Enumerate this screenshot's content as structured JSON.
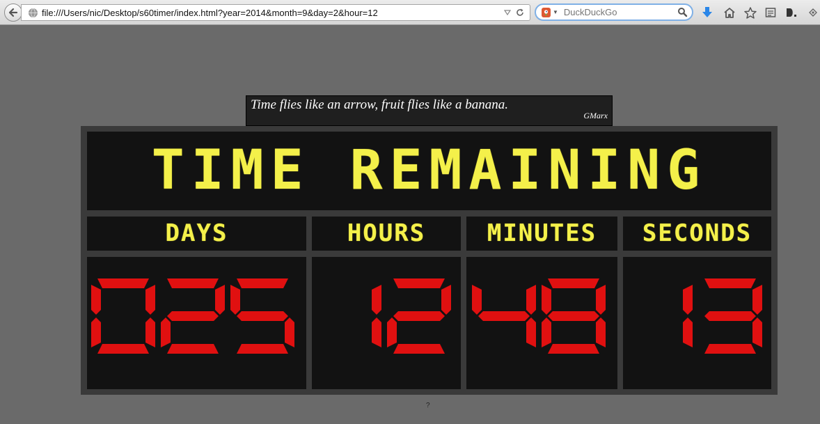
{
  "browser": {
    "url": "file:///Users/nic/Desktop/s60timer/index.html?year=2014&month=9&day=2&hour=12",
    "search_placeholder": "DuckDuckGo",
    "search_engine_icon": "duckduckgo-icon"
  },
  "quote": {
    "text": "Time flies like an arrow, fruit flies like a banana.",
    "author": "GMarx"
  },
  "board": {
    "title": "TIME REMAINING",
    "units": [
      {
        "label": "DAYS",
        "value": "025"
      },
      {
        "label": "HOURS",
        "value": "12"
      },
      {
        "label": "MINUTES",
        "value": "48"
      },
      {
        "label": "SECONDS",
        "value": "13"
      }
    ]
  },
  "footer": {
    "mark": "?"
  },
  "colors": {
    "page_background": "#6a6a6a",
    "board_frame": "#3a3a3a",
    "panel_background": "#121212",
    "label_yellow": "#f4f04a",
    "digit_red": "#e01010"
  }
}
